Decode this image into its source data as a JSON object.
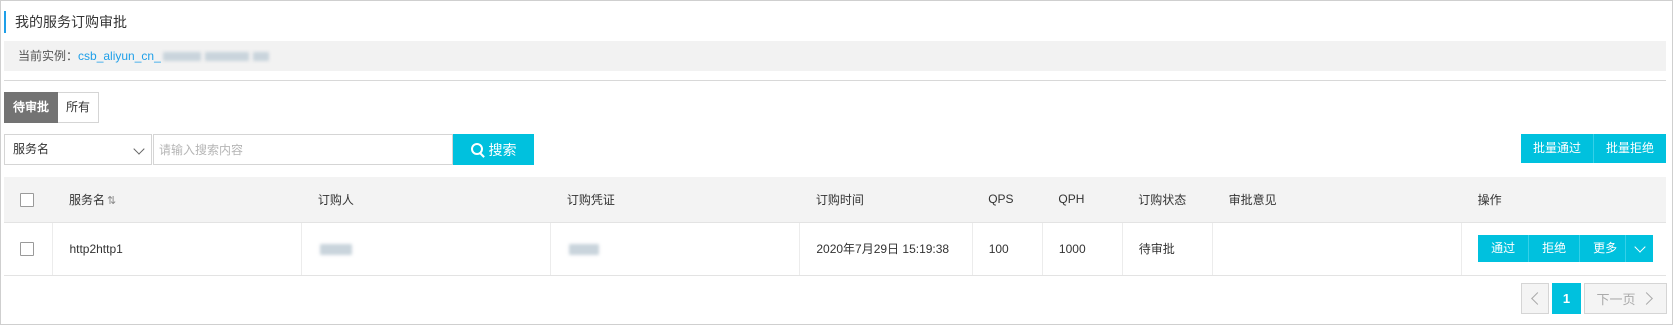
{
  "page": {
    "title": "我的服务订购审批"
  },
  "instance": {
    "label": "当前实例：",
    "name": "csb_aliyun_cn_"
  },
  "tabs": [
    {
      "label": "待审批",
      "active": true
    },
    {
      "label": "所有",
      "active": false
    }
  ],
  "filter": {
    "field_selected": "服务名",
    "search_placeholder": "请输入搜索内容",
    "search_button": "搜索"
  },
  "batch": {
    "approve": "批量通过",
    "reject": "批量拒绝"
  },
  "table": {
    "headers": [
      "服务名",
      "订购人",
      "订购凭证",
      "订购时间",
      "QPS",
      "QPH",
      "订购状态",
      "审批意见",
      "操作"
    ],
    "rows": [
      {
        "service": "http2http1",
        "subscriber": "",
        "credential": "",
        "time": "2020年7月29日 15:19:38",
        "qps": "100",
        "qph": "1000",
        "status": "待审批",
        "opinion": "",
        "actions": {
          "approve": "通过",
          "reject": "拒绝",
          "more": "更多"
        }
      }
    ]
  },
  "pagination": {
    "current": "1",
    "next": "下一页"
  },
  "colors": {
    "accent": "#00c1de",
    "tab_active": "#737373",
    "link": "#1e9fe8"
  }
}
